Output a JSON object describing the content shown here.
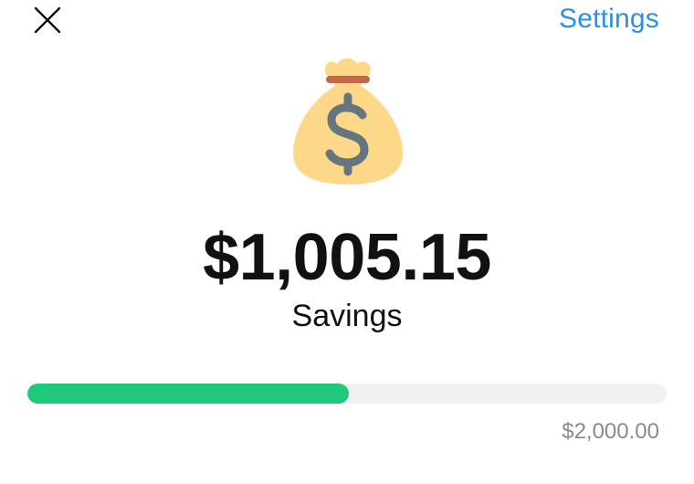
{
  "header": {
    "close_icon": "close-icon",
    "settings_label": "Settings"
  },
  "savings": {
    "icon": "money-bag-icon",
    "balance": "$1,005.15",
    "label": "Savings",
    "goal": "$2,000.00",
    "progress_fraction": 0.5026
  },
  "colors": {
    "accent": "#2e8fe0",
    "progress": "#1ec97b",
    "track": "#f1f1f1",
    "bag": "#fdd888",
    "bag_tie": "#c1694f",
    "dollar": "#67757f"
  }
}
